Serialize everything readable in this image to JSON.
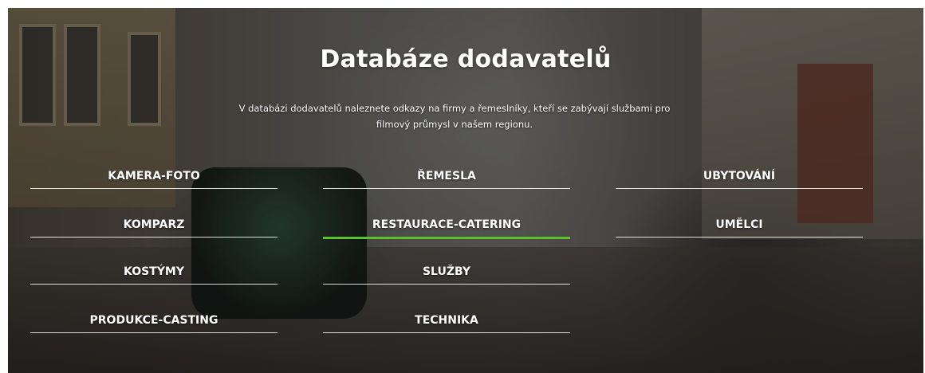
{
  "hero": {
    "title": "Databáze dodavatelů",
    "intro_line1": "V databázi dodavatelů naleznete odkazy na firmy a řemeslníky, kteří se zabývají službami pro",
    "intro_line2": "filmový průmysl v našem regionu."
  },
  "categories": {
    "col1": [
      "KAMERA-FOTO",
      "KOMPARZ",
      "KOSTÝMY",
      "PRODUKCE-CASTING"
    ],
    "col2": [
      "ŘEMESLA",
      "RESTAURACE-CATERING",
      "SLUŽBY",
      "TECHNIKA"
    ],
    "col3": [
      "UBYTOVÁNÍ",
      "UMĚLCI"
    ]
  },
  "active_category": "RESTAURACE-CATERING",
  "colors": {
    "accent": "#5bbf2e",
    "text": "#ffffff"
  }
}
